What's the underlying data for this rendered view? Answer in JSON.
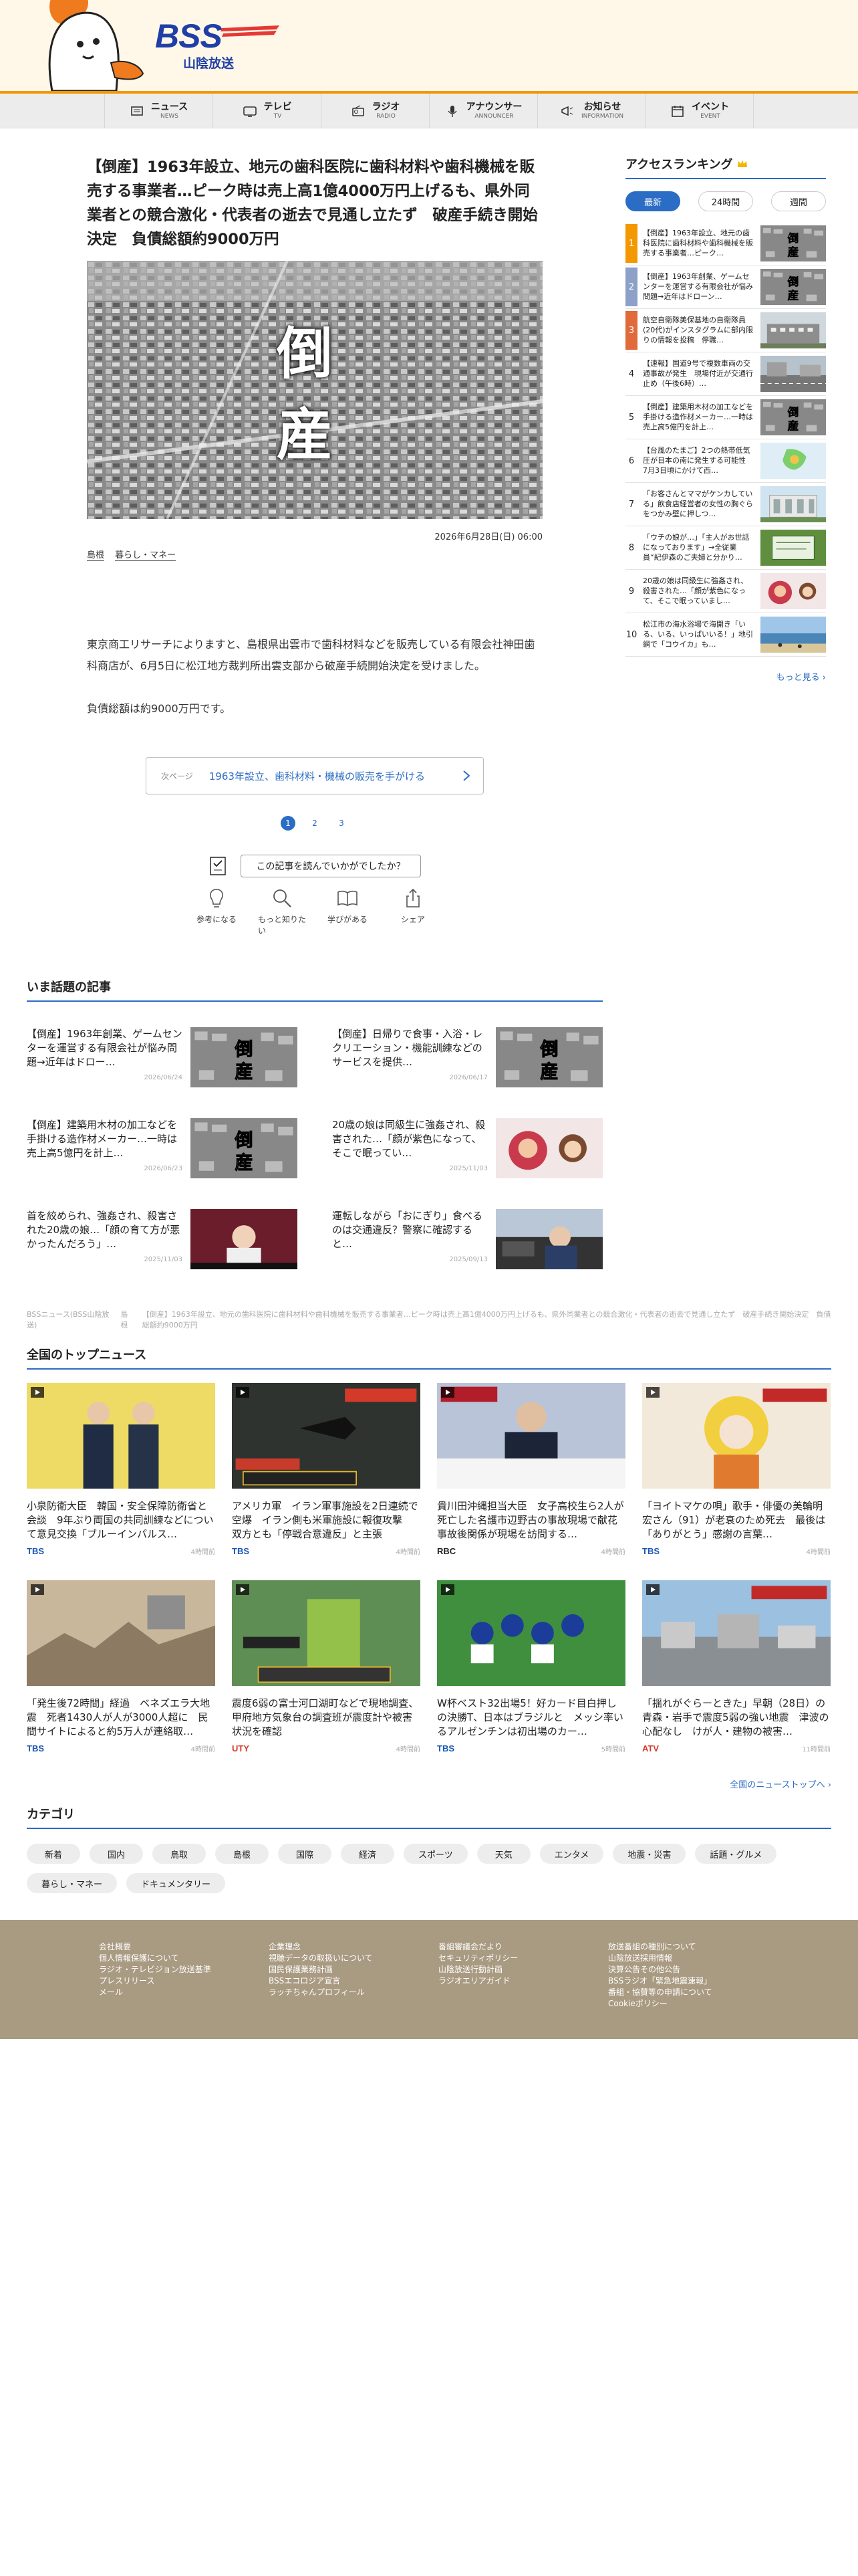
{
  "logo": {
    "text": "BSS",
    "sub": "山陰放送"
  },
  "gnav": [
    {
      "ja": "ニュース",
      "en": "NEWS",
      "icon": "news-icon"
    },
    {
      "ja": "テレビ",
      "en": "TV",
      "icon": "tv-icon"
    },
    {
      "ja": "ラジオ",
      "en": "RADIO",
      "icon": "radio-icon"
    },
    {
      "ja": "アナウンサー",
      "en": "ANNOUNCER",
      "icon": "microphone-icon"
    },
    {
      "ja": "お知らせ",
      "en": "INFORMATION",
      "icon": "megaphone-icon"
    },
    {
      "ja": "イベント",
      "en": "EVENT",
      "icon": "calendar-icon"
    }
  ],
  "article": {
    "title": "【倒産】1963年設立、地元の歯科医院に歯科材料や歯科機械を販売する事業者…ピーク時は売上高1億4000万円上げるも、県外同業者との競合激化・代表者の逝去で見通し立たず　破産手続き開始決定　負債総額約9000万円",
    "hero_text": [
      "倒",
      "産"
    ],
    "date": "2026年6月28日(日) 06:00",
    "tags": [
      "島根",
      "暮らし・マネー"
    ],
    "body": [
      "東京商工リサーチによりますと、島根県出雲市で歯科材料などを販売している有限会社神田歯科商店が、6月5日に松江地方裁判所出雲支部から破産手続開始決定を受けました。",
      "負債総額は約9000万円です。"
    ],
    "next_label": "次ページ",
    "next_text": "1963年設立、歯科材料・機械の販売を手がける",
    "pages": [
      "1",
      "2",
      "3"
    ]
  },
  "feedback": {
    "question": "この記事を読んでいかがでしたか？",
    "buttons": [
      {
        "label": "参考になる",
        "icon": "lightbulb-icon"
      },
      {
        "label": "もっと知りたい",
        "icon": "magnifier-icon"
      },
      {
        "label": "学びがある",
        "icon": "book-icon"
      },
      {
        "label": "シェア",
        "icon": "share-icon"
      }
    ]
  },
  "ranking": {
    "title": "アクセスランキング",
    "tabs": [
      "最新",
      "24時間",
      "週間"
    ],
    "items": [
      {
        "no": "1",
        "text": "【倒産】1963年設立、地元の歯科医院に歯科材料や歯科機械を販売する事業者…ピーク…",
        "thumb": "tosan"
      },
      {
        "no": "2",
        "text": "【倒産】1963年創業、ゲームセンターを運営する有限会社が悩み問題→近年はドローン…",
        "thumb": "tosan"
      },
      {
        "no": "3",
        "text": "航空自衛隊美保基地の自衛隊員(20代)がインスタグラムに部内限りの情報を投稿　停職…",
        "thumb": "building"
      },
      {
        "no": "4",
        "text": "【速報】国道9号で複数車両の交通事故が発生　現場付近が交通行止め（午後6時）…",
        "thumb": "road"
      },
      {
        "no": "5",
        "text": "【倒産】建築用木材の加工などを手掛ける造作材メーカー…一時は売上高5億円を計上…",
        "thumb": "tosan"
      },
      {
        "no": "6",
        "text": "【台風のたまご】2つの熱帯低気圧が日本の南に発生する可能性　7月3日頃にかけて西…",
        "thumb": "map"
      },
      {
        "no": "7",
        "text": "「お客さんとママがケンカしている」飲食店経営者の女性の胸ぐらをつかみ壁に押しつ…",
        "thumb": "courthouse"
      },
      {
        "no": "8",
        "text": "「ウチの娘が…」「主人がお世話になっております」→全従業員“紀伊森のご夫婦と分かり…",
        "thumb": "green"
      },
      {
        "no": "9",
        "text": "20歳の娘は同級生に強姦され、殺害された…「顔が紫色になって、そこで眠っていまし…",
        "thumb": "portrait"
      },
      {
        "no": "10",
        "text": "松江市の海水浴場で海開き「いる、いる、いっぱいいる！」地引網で「コウイカ」も…",
        "thumb": "beach"
      }
    ],
    "more": "もっと見る"
  },
  "hot": {
    "title": "いま話題の記事",
    "items": [
      {
        "text": "【倒産】1963年創業、ゲームセンターを運営する有限会社が悩み問題→近年はドロー…",
        "date": "2026/06/24",
        "thumb": "tosan"
      },
      {
        "text": "【倒産】日帰りで食事・入浴・レクリエーション・機能訓練などのサービスを提供…",
        "date": "2026/06/17",
        "thumb": "tosan"
      },
      {
        "text": "【倒産】建築用木材の加工などを手掛ける造作材メーカー…一時は売上高5億円を計上…",
        "date": "2026/06/23",
        "thumb": "tosan"
      },
      {
        "text": "20歳の娘は同級生に強姦され、殺害された…「顔が紫色になって、そこで眠ってい…",
        "date": "2025/11/03",
        "thumb": "portrait"
      },
      {
        "text": "首を絞められ、強姦され、殺害された20歳の娘…「顔の育て方が悪かったんだろう」…",
        "date": "2025/11/03",
        "thumb": "woman"
      },
      {
        "text": "運転しながら「おにぎり」食べるのは交通違反？警察に確認すると…",
        "date": "2025/09/13",
        "thumb": "car"
      }
    ]
  },
  "breadcrumb": {
    "items": [
      "BSSニュース(BSS山陰放送)",
      "島根",
      "【倒産】1963年設立、地元の歯科医院に歯科材料や歯科機械を販売する事業者…ピーク時は売上高1億4000万円上げるも、県外同業者との競合激化・代表者の逝去で見通し立たず　破産手続き開始決定　負債総額約9000万円"
    ]
  },
  "top_news": {
    "title": "全国のトップニュース",
    "items": [
      {
        "text": "小泉防衛大臣　韓国・安全保障防衛省と会談　9年ぶり両国の共同訓練などについて意見交換「ブルーインパルス…",
        "source": "TBS",
        "time": "4時間前",
        "thumb": "ministers",
        "color": "#1a56b5"
      },
      {
        "text": "アメリカ軍　イラン軍事施設を2日連続で空爆　イラン側も米軍施設に報復攻撃　双方とも「停戦合意違反」と主張",
        "source": "TBS",
        "time": "4時間前",
        "thumb": "drone",
        "color": "#1a56b5"
      },
      {
        "text": "貴川田沖縄担当大臣　女子高校生ら2人が死亡した名護市辺野古の事故現場で献花　事故後関係が現場を訪問する…",
        "source": "RBC",
        "time": "4時間前",
        "thumb": "minister",
        "color": "#222222"
      },
      {
        "text": "「ヨイトマケの唄」歌手・俳優の美輪明宏さん（91）が老衰のため死去　最後は「ありがとう」感謝の言葉…",
        "source": "TBS",
        "time": "4時間前",
        "thumb": "singer",
        "color": "#1a56b5"
      },
      {
        "text": "「発生後72時間」経過　ベネズエラ大地震　死者1430人が人が3000人超に　民間サイトによると約5万人が連絡取…",
        "source": "TBS",
        "time": "4時間前",
        "thumb": "rubble",
        "color": "#1a56b5"
      },
      {
        "text": "震度6弱の富士河口湖町などで現地調査、甲府地方気象台の調査班が震度計や被害状況を確認",
        "source": "UTY",
        "time": "4時間前",
        "thumb": "survey",
        "color": "#d43a2a"
      },
      {
        "text": "W杯ベスト32出場5！好カード目白押しの決勝T、日本はブラジルと　メッシ率いるアルゼンチンは初出場のカー…",
        "source": "TBS",
        "time": "5時間前",
        "thumb": "soccer",
        "color": "#1a56b5"
      },
      {
        "text": "「揺れがぐらーときた」早朝（28日）の青森・岩手で震度5弱の強い地震　津波の心配なし　けが人・建物の被害…",
        "source": "ATV",
        "time": "11時間前",
        "thumb": "town",
        "color": "#d43a2a"
      }
    ],
    "more": "全国のニューストップへ"
  },
  "categories": {
    "title": "カテゴリ",
    "items": [
      "新着",
      "国内",
      "鳥取",
      "島根",
      "国際",
      "経済",
      "スポーツ",
      "天気",
      "エンタメ",
      "地震・災害",
      "話題・グルメ",
      "暮らし・マネー",
      "ドキュメンタリー"
    ]
  },
  "footer": {
    "cols": [
      [
        "会社概要",
        "個人情報保護について",
        "ラジオ・テレビジョン放送基準",
        "プレスリリース",
        "メール"
      ],
      [
        "企業理念",
        "視聴データの取扱いについて",
        "国民保護業務計画",
        "BSSエコロジア宣言",
        "ラッチちゃんプロフィール"
      ],
      [
        "番組審議会だより",
        "セキュリティポリシー",
        "山陰放送行動計画",
        "ラジオエリアガイド"
      ],
      [
        "放送番組の種別について",
        "山陰放送採用情報",
        "決算公告その他公告",
        "BSSラジオ「緊急地震速報」",
        "番組・協賛等の申請について",
        "Cookieポリシー"
      ]
    ]
  },
  "colors": {
    "accent": "#2b6cc4",
    "brand": "#1f3fa6",
    "orange": "#f39800",
    "footer": "#a99a82"
  }
}
